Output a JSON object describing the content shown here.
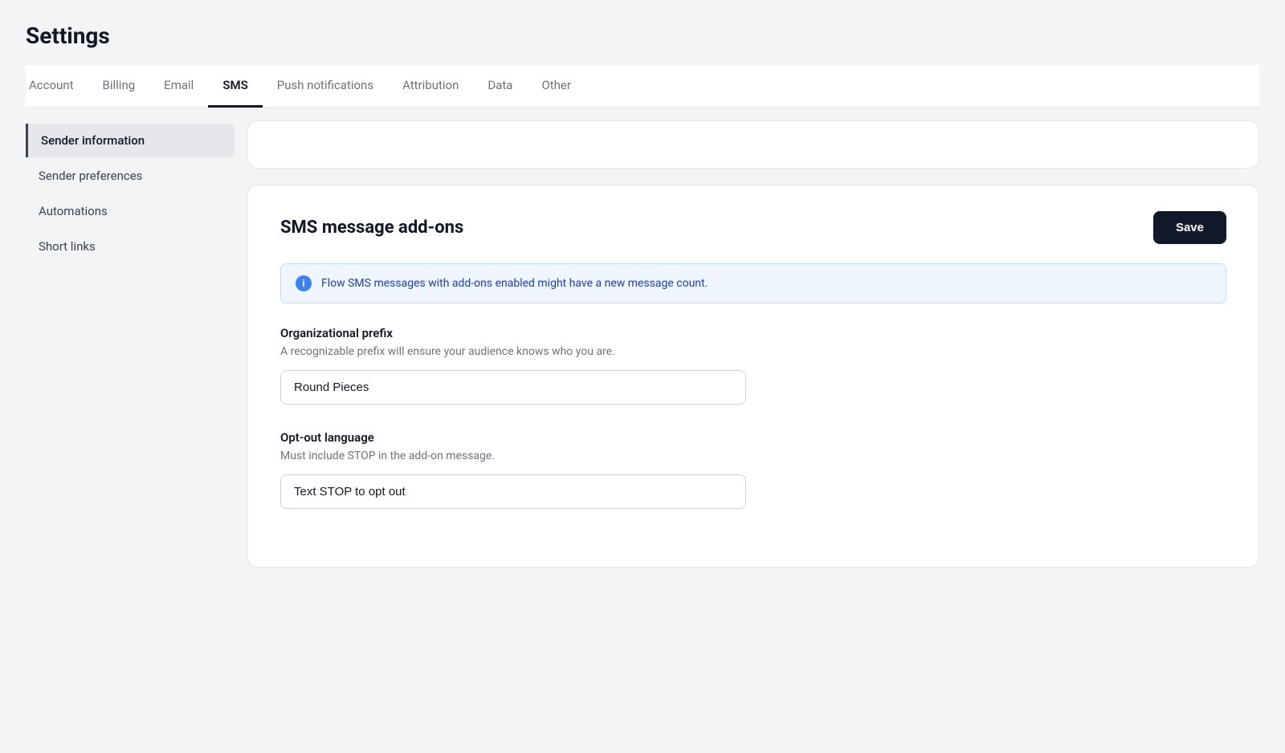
{
  "page": {
    "title": "Settings"
  },
  "tabs": {
    "items": [
      {
        "id": "account",
        "label": "Account",
        "active": false
      },
      {
        "id": "billing",
        "label": "Billing",
        "active": false
      },
      {
        "id": "email",
        "label": "Email",
        "active": false
      },
      {
        "id": "sms",
        "label": "SMS",
        "active": true
      },
      {
        "id": "push-notifications",
        "label": "Push notifications",
        "active": false
      },
      {
        "id": "attribution",
        "label": "Attribution",
        "active": false
      },
      {
        "id": "data",
        "label": "Data",
        "active": false
      },
      {
        "id": "other",
        "label": "Other",
        "active": false
      }
    ]
  },
  "sidebar": {
    "items": [
      {
        "id": "sender-information",
        "label": "Sender information",
        "active": true
      },
      {
        "id": "sender-preferences",
        "label": "Sender preferences",
        "active": false
      },
      {
        "id": "automations",
        "label": "Automations",
        "active": false
      },
      {
        "id": "short-links",
        "label": "Short links",
        "active": false
      }
    ]
  },
  "main": {
    "card_title": "SMS message add-ons",
    "save_button_label": "Save",
    "info_banner_text": "Flow SMS messages with add-ons enabled might have a new message count.",
    "org_prefix": {
      "label": "Organizational prefix",
      "description": "A recognizable prefix will ensure your audience knows who you are.",
      "value": "Round Pieces",
      "placeholder": "Round Pieces"
    },
    "opt_out": {
      "label": "Opt-out language",
      "description": "Must include STOP in the add-on message.",
      "value": "Text STOP to opt out",
      "placeholder": "Text STOP to opt out"
    }
  }
}
